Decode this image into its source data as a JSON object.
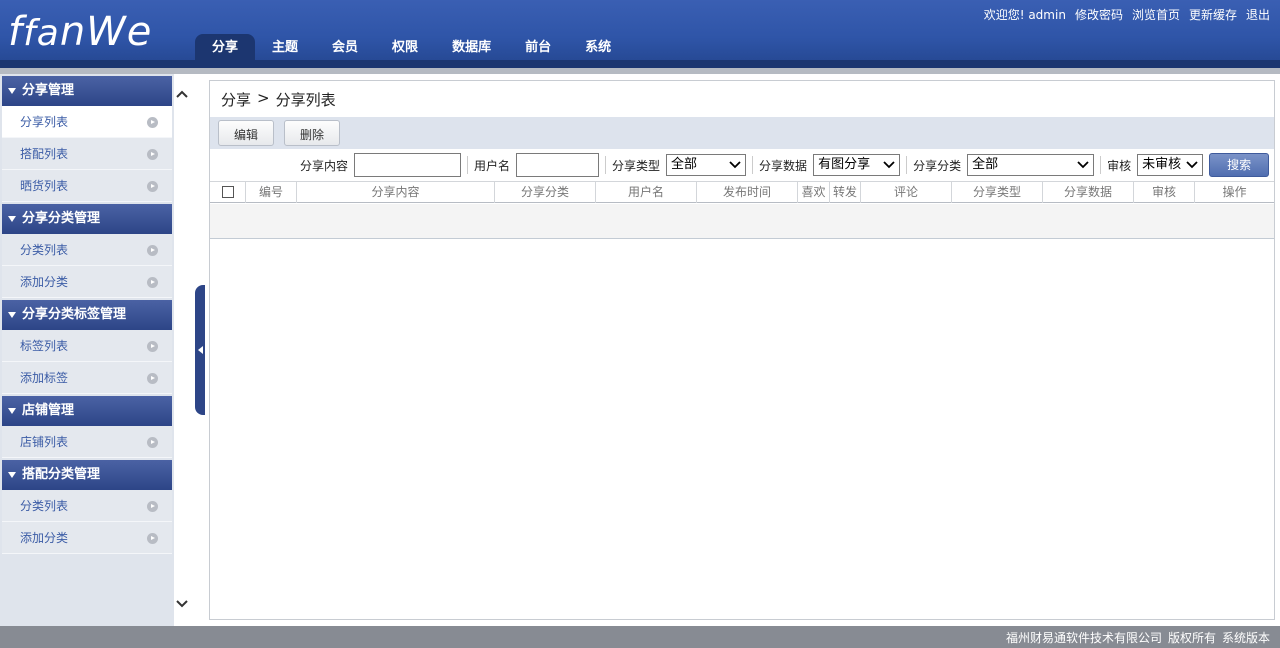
{
  "header": {
    "logo_main": "fa",
    "logo_rest": "nWe",
    "nav": [
      {
        "label": "分享",
        "active": true
      },
      {
        "label": "主题",
        "active": false
      },
      {
        "label": "会员",
        "active": false
      },
      {
        "label": "权限",
        "active": false
      },
      {
        "label": "数据库",
        "active": false
      },
      {
        "label": "前台",
        "active": false
      },
      {
        "label": "系统",
        "active": false
      }
    ],
    "links": {
      "welcome": "欢迎您! admin",
      "change_password": "修改密码",
      "browse_home": "浏览首页",
      "update_cache": "更新缓存",
      "logout": "退出"
    }
  },
  "sidebar": {
    "groups": [
      {
        "title": "分享管理",
        "items": [
          {
            "label": "分享列表",
            "active": true
          },
          {
            "label": "搭配列表",
            "active": false
          },
          {
            "label": "晒货列表",
            "active": false
          }
        ]
      },
      {
        "title": "分享分类管理",
        "items": [
          {
            "label": "分类列表",
            "active": false
          },
          {
            "label": "添加分类",
            "active": false
          }
        ]
      },
      {
        "title": "分享分类标签管理",
        "items": [
          {
            "label": "标签列表",
            "active": false
          },
          {
            "label": "添加标签",
            "active": false
          }
        ]
      },
      {
        "title": "店铺管理",
        "items": [
          {
            "label": "店铺列表",
            "active": false
          }
        ]
      },
      {
        "title": "搭配分类管理",
        "items": [
          {
            "label": "分类列表",
            "active": false
          },
          {
            "label": "添加分类",
            "active": false
          }
        ]
      }
    ]
  },
  "main": {
    "breadcrumb": {
      "section": "分享",
      "separator": ">",
      "page": "分享列表"
    },
    "toolbar": {
      "edit": "编辑",
      "delete": "删除"
    },
    "search": {
      "content_label": "分享内容",
      "content_value": "",
      "username_label": "用户名",
      "username_value": "",
      "type_label": "分享类型",
      "type_value": "全部",
      "data_label": "分享数据",
      "data_value": "有图分享",
      "category_label": "分享分类",
      "category_value": "全部",
      "audit_label": "审核",
      "audit_value": "未审核",
      "search_button": "搜索"
    },
    "table": {
      "columns": [
        "编号",
        "分享内容",
        "分享分类",
        "用户名",
        "发布时间",
        "喜欢",
        "转发",
        "评论",
        "分享类型",
        "分享数据",
        "审核",
        "操作"
      ],
      "rows": []
    }
  },
  "footer": {
    "company": "福州财易通软件技术有限公司",
    "rights": "版权所有",
    "version": "系统版本"
  },
  "colors": {
    "header_blue": "#2f55a8",
    "nav_active": "#1c3670",
    "sidebar_title": "#2d4587",
    "link_blue": "#3b5ca6"
  },
  "icons": [
    "chevron-up-icon",
    "chevron-down-icon",
    "collapse-arrow-icon",
    "arrow-circle-icon",
    "triangle-down-icon",
    "select-chevron-icon"
  ]
}
